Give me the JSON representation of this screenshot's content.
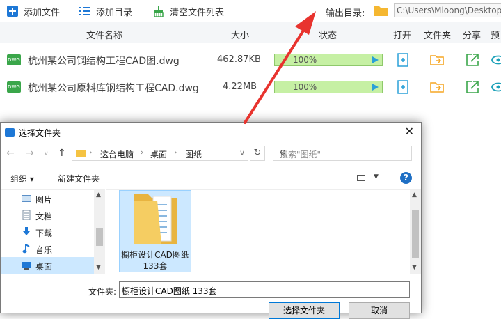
{
  "toolbar": {
    "add_file": "添加文件",
    "add_folder": "添加目录",
    "clear_list": "清空文件列表",
    "output_label": "输出目录:",
    "output_path": "C:\\Users\\Mloong\\Desktop"
  },
  "table": {
    "headers": {
      "name": "文件名称",
      "size": "大小",
      "status": "状态",
      "open": "打开",
      "folder": "文件夹",
      "share": "分享",
      "preview": "预"
    },
    "rows": [
      {
        "icon_text": "DWG",
        "name": "杭州某公司钢结构工程CAD图.dwg",
        "size": "462.87KB",
        "progress_text": "100%",
        "progress": 1.0
      },
      {
        "icon_text": "DWG",
        "name": "杭州某公司原料库钢结构工程CAD.dwg",
        "size": "4.22MB",
        "progress_text": "100%",
        "progress": 1.0
      }
    ]
  },
  "dialog": {
    "title": "选择文件夹",
    "breadcrumb": [
      "这台电脑",
      "桌面",
      "图纸"
    ],
    "search_placeholder": "搜索\"图纸\"",
    "organize": "组织 ▾",
    "new_folder": "新建文件夹",
    "help": "?",
    "tree": [
      {
        "label": "图片",
        "icon": "pictures-icon",
        "selected": false
      },
      {
        "label": "文档",
        "icon": "documents-icon",
        "selected": false
      },
      {
        "label": "下载",
        "icon": "downloads-icon",
        "selected": false
      },
      {
        "label": "音乐",
        "icon": "music-icon",
        "selected": false
      },
      {
        "label": "桌面",
        "icon": "desktop-icon",
        "selected": true
      }
    ],
    "folder_tile_label": "橱柜设计CAD图纸 133套",
    "folder_field_label": "文件夹:",
    "folder_field_value": "橱柜设计CAD图纸 133套",
    "select_button": "选择文件夹",
    "cancel_button": "取消"
  },
  "colors": {
    "accent": "#1e78d6",
    "progress": "#c6f0a4",
    "arrow": "#e8332e",
    "folder": "#f5b731"
  }
}
